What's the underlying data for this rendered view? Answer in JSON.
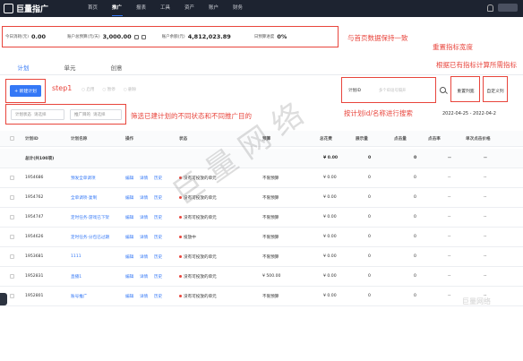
{
  "topbar": {
    "logo": "巨量指广",
    "nav": [
      "首页",
      "推广",
      "报表",
      "工具",
      "资产",
      "账户",
      "财务"
    ],
    "active_nav": "推广"
  },
  "stats": [
    {
      "label": "今日消耗(元)",
      "value": "0.00"
    },
    {
      "label": "账户总预算(元/天)",
      "value": "3,000.00"
    },
    {
      "label": "账户余额(元)",
      "value": "4,812,023.89"
    },
    {
      "label": "日预算进度",
      "value": "0%"
    }
  ],
  "annotations": {
    "keep_consistent": "与首页数据保持一致",
    "reset_width": "重置指标宽度",
    "recalc": "根据已有指标计算所需指标",
    "step": "step1",
    "filter_note": "筛选已建计划的不同状态和不同推广目的",
    "search_note": "按计划id/名称进行搜索"
  },
  "tabs": [
    "计划",
    "单元",
    "创意"
  ],
  "active_tab": "计划",
  "toolbar": {
    "new_plan": "+ 新建计划",
    "actions": [
      "启用",
      "暂停",
      "删除"
    ]
  },
  "search": {
    "select": "计划ID",
    "placeholder": "多个ID逗号隔开"
  },
  "buttons": {
    "reset_columns": "重置列宽",
    "custom_columns": "自定义列"
  },
  "filters": {
    "status_label": "计划状态",
    "status_placeholder": "请选择",
    "purpose_label": "推广目的",
    "purpose_placeholder": "请选择"
  },
  "date_range": "2022-04-25 - 2022-04-2",
  "table": {
    "headers": [
      "计划ID",
      "计划名称",
      "操作",
      "状态",
      "预算",
      "总花费",
      "展示量",
      "点击量",
      "点击率",
      "单次点击价格"
    ],
    "total": {
      "label": "总计(共100项)",
      "cost": "¥ 0.00",
      "impr": "0",
      "clicks": "0",
      "ctr": "--",
      "cpc": "--"
    },
    "op_links": [
      "编辑",
      "详情",
      "历史"
    ],
    "rows": [
      {
        "id": "1954686",
        "name": "预发全单调项",
        "status": "没有可投放的单元",
        "budget": "不限预算",
        "cost": "¥ 0.00",
        "impr": "0",
        "clicks": "0",
        "ctr": "--",
        "cpc": "--"
      },
      {
        "id": "1954762",
        "name": "全单调项-复制",
        "status": "没有可投放的单元",
        "budget": "不限预算",
        "cost": "¥ 0.00",
        "impr": "0",
        "clicks": "0",
        "ctr": "--",
        "cpc": "--"
      },
      {
        "id": "1954747",
        "name": "定时任务-游戏已下架",
        "status": "没有可投放的单元",
        "budget": "不限预算",
        "cost": "¥ 0.00",
        "impr": "0",
        "clicks": "0",
        "ctr": "--",
        "cpc": "--"
      },
      {
        "id": "1954626",
        "name": "定时任务-分包已过期",
        "status": "投放中",
        "budget": "不限预算",
        "cost": "¥ 0.00",
        "impr": "0",
        "clicks": "0",
        "ctr": "--",
        "cpc": "--"
      },
      {
        "id": "1953681",
        "name": "1111",
        "status": "没有可投放的单元",
        "budget": "不限预算",
        "cost": "¥ 0.00",
        "impr": "0",
        "clicks": "0",
        "ctr": "--",
        "cpc": "--"
      },
      {
        "id": "1952831",
        "name": "直播1",
        "status": "没有可投放的单元",
        "budget": "¥ 500.00",
        "cost": "¥ 0.00",
        "impr": "0",
        "clicks": "0",
        "ctr": "--",
        "cpc": "--"
      },
      {
        "id": "1952801",
        "name": "账号推广",
        "status": "没有可投放的单元",
        "budget": "不限预算",
        "cost": "¥ 0.00",
        "impr": "0",
        "clicks": "0",
        "ctr": "--",
        "cpc": "--"
      }
    ]
  },
  "watermark": "巨 量 网 络",
  "watermark_small": "巨量网络",
  "colors": {
    "accent": "#3478f6",
    "annotation": "#e8453c",
    "topbar": "#1d2330"
  }
}
